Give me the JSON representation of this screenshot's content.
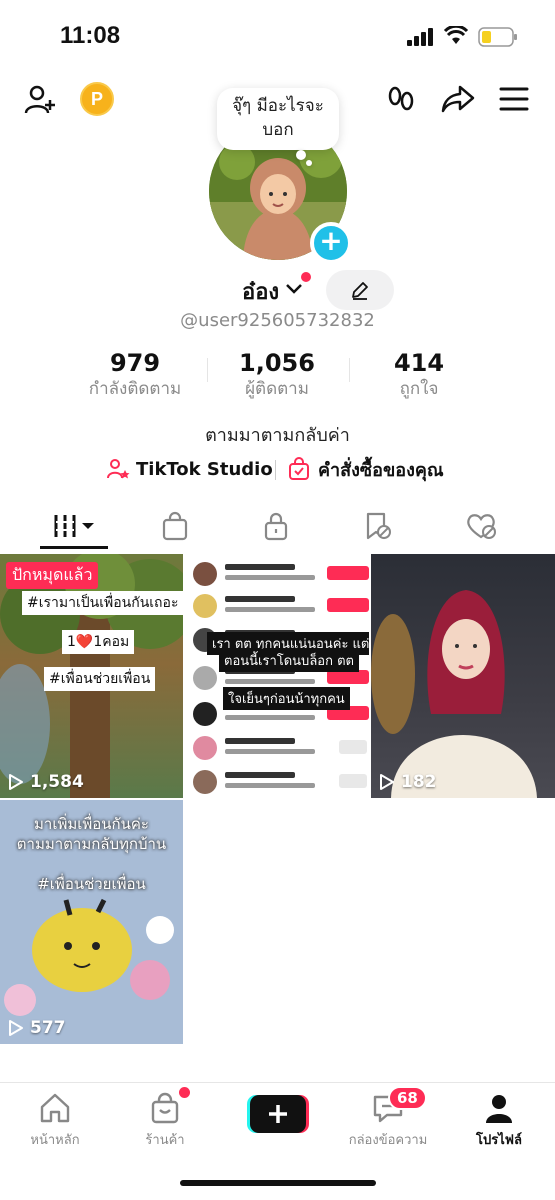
{
  "status_bar": {
    "time": "11:08"
  },
  "header": {
    "coin_letter": "P",
    "avatar_bubble": "จุ๊ๆ มีอะไรจะบอก"
  },
  "profile": {
    "name": "อ๋อง",
    "username": "@user925605732832",
    "bio": "ตามมาตามกลับค่า"
  },
  "stats": [
    {
      "value": "979",
      "label": "กำลังติดตาม"
    },
    {
      "value": "1,056",
      "label": "ผู้ติดตาม"
    },
    {
      "value": "414",
      "label": "ถูกใจ"
    }
  ],
  "links": {
    "studio": "TikTok Studio",
    "orders": "คำสั่งซื้อของคุณ"
  },
  "tabs": [
    "videos-grid-icon",
    "shop-bag-icon",
    "lock-icon",
    "bookmark-hidden-icon",
    "liked-hidden-icon"
  ],
  "videos": [
    {
      "views": "1,584",
      "pinned": "ปักหมุดแล้ว",
      "captions": [
        "#เรามาเป็นเพื่อนกันเถอะ",
        "1❤️1คอม",
        "#เพื่อนช่วยเพื่อน"
      ]
    },
    {
      "views": "",
      "captions": [
        "เรา ตต ทุกคนแน่นอนค่ะ แต่",
        "ตอนนี้เราโดนบล็อก ตต",
        "ใจเย็นๆก่อนน้าทุกคน"
      ]
    },
    {
      "views": "182"
    },
    {
      "views": "577",
      "captions": [
        "มาเพิ่มเพื่อนกันค่ะ",
        "ตามมาตามกลับทุกบ้าน",
        "#เพื่อนช่วยเพื่อน"
      ]
    }
  ],
  "bottom_nav": {
    "home": "หน้าหลัก",
    "shop": "ร้านค้า",
    "inbox": "กล่องข้อความ",
    "inbox_badge": "68",
    "profile": "โปรไฟล์"
  },
  "colors": {
    "accent": "#fe2c55",
    "cyan": "#20c0e8",
    "coin": "#f7b21b"
  }
}
